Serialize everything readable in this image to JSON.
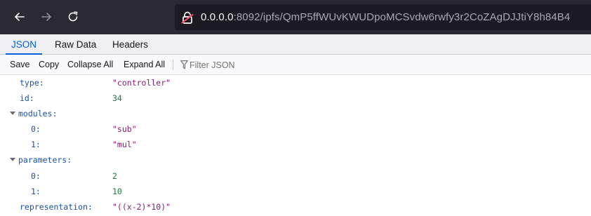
{
  "browser": {
    "url_host": "0.0.0.0",
    "url_rest": ":8092/ipfs/QmP5ffWUvKWUDpoMCSvdw6rwfy3r2CoZAgDJJtiY8h84B4"
  },
  "tabs": [
    {
      "label": "JSON",
      "selected": true
    },
    {
      "label": "Raw Data",
      "selected": false
    },
    {
      "label": "Headers",
      "selected": false
    }
  ],
  "actions": {
    "save": "Save",
    "copy": "Copy",
    "collapse_all": "Collapse All",
    "expand_all": "Expand All",
    "filter_placeholder": "Filter JSON"
  },
  "json": {
    "type_key": "type:",
    "type_val": "\"controller\"",
    "id_key": "id:",
    "id_val": "34",
    "modules_key": "modules:",
    "modules": [
      {
        "key": "0:",
        "val": "\"sub\""
      },
      {
        "key": "1:",
        "val": "\"mul\""
      }
    ],
    "parameters_key": "parameters:",
    "parameters": [
      {
        "key": "0:",
        "val": "2"
      },
      {
        "key": "1:",
        "val": "10"
      }
    ],
    "representation_key": "representation:",
    "representation_val": "\"((x-2)*10)\""
  },
  "colors": {
    "toolbar_bg": "#2b2a33",
    "accent": "#0060df",
    "key": "#1a52a3",
    "string": "#8b1a73",
    "number": "#1f7a3a"
  }
}
